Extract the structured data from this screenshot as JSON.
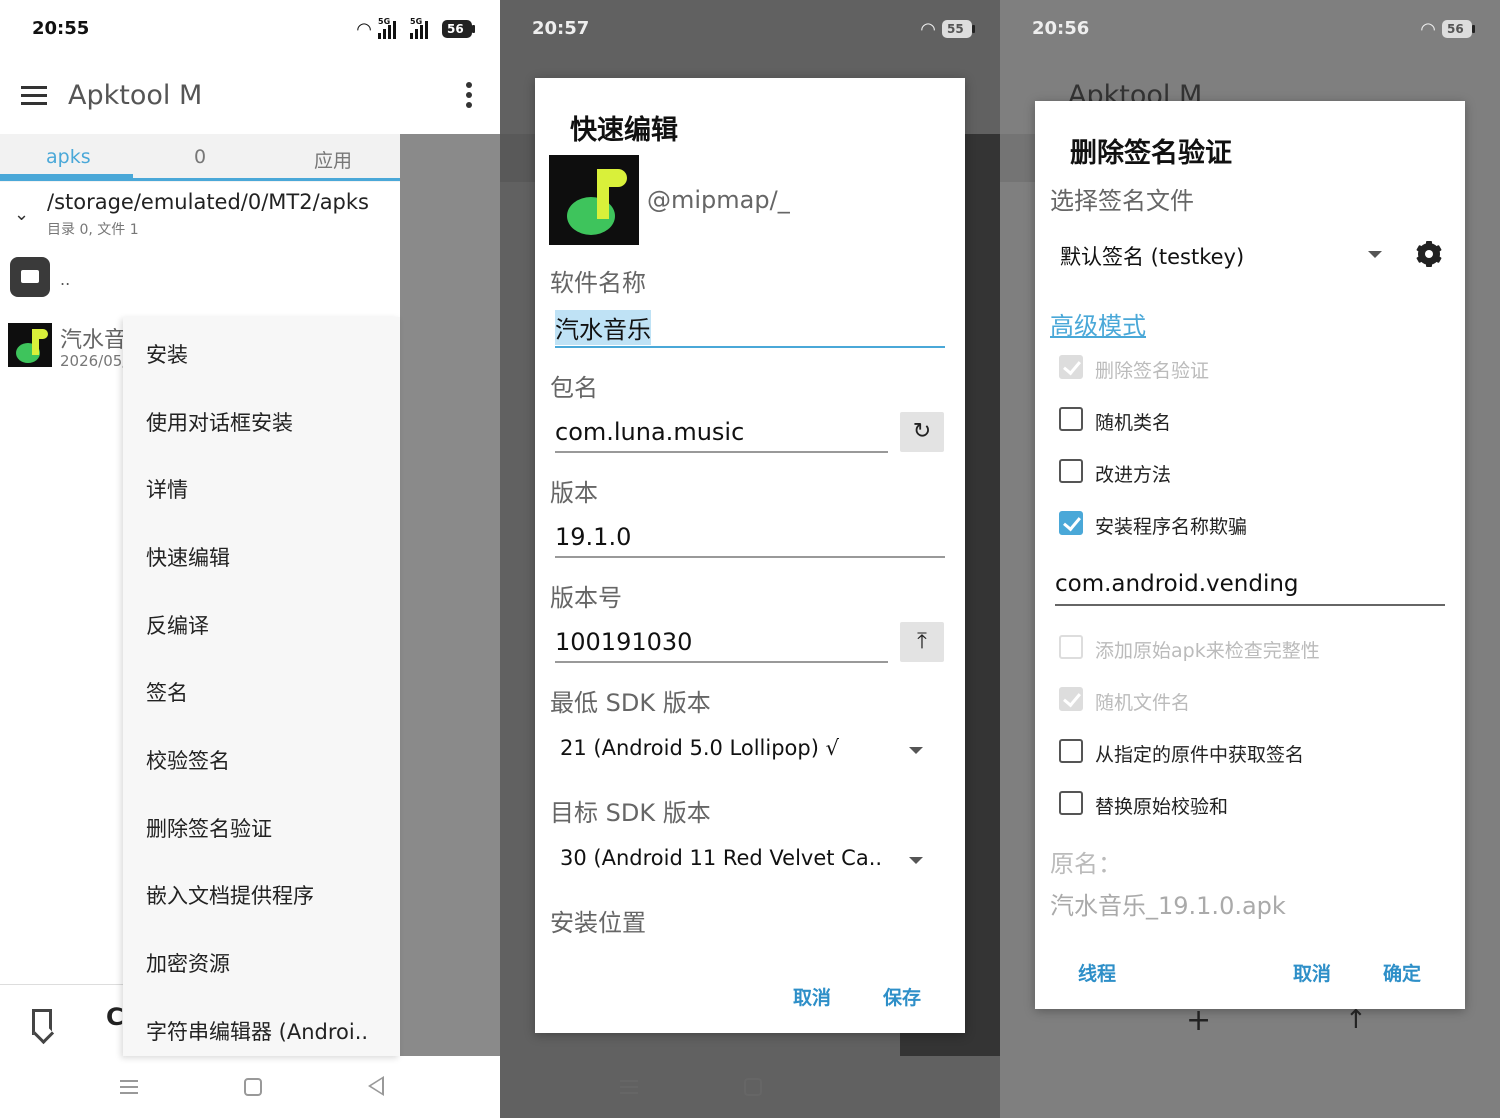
{
  "panel1": {
    "status": {
      "time": "20:55",
      "battery": "56"
    },
    "appbar": {
      "title": "Apktool M"
    },
    "tabs": [
      "apks",
      "0",
      "应用"
    ],
    "path": {
      "text": "/storage/emulated/0/MT2/apks",
      "sub": "目录 0, 文件 1"
    },
    "parent_dir": "..",
    "file": {
      "name": "汽水音",
      "date": "2026/05/"
    },
    "bottom_c": "C",
    "menu": [
      "安装",
      "使用对话框安装",
      "详情",
      "快速编辑",
      "反编译",
      "签名",
      "校验签名",
      "删除签名验证",
      "嵌入文档提供程序",
      "加密资源",
      "字符串编辑器 (Androi.."
    ]
  },
  "panel2": {
    "status": {
      "time": "20:57",
      "battery": "55"
    },
    "dialog": {
      "title": "快速编辑",
      "handle": "@mipmap/_",
      "app_name_label": "软件名称",
      "app_name": "汽水音乐",
      "package_label": "包名",
      "package": "com.luna.music",
      "version_label": "版本",
      "version": "19.1.0",
      "version_code_label": "版本号",
      "version_code": "100191030",
      "min_sdk_label": "最低 SDK 版本",
      "min_sdk": "21 (Android 5.0 Lollipop) √",
      "target_sdk_label": "目标 SDK 版本",
      "target_sdk": "30 (Android 11 Red Velvet Ca..",
      "install_location_label": "安装位置",
      "cancel": "取消",
      "save": "保存"
    }
  },
  "panel3": {
    "status": {
      "time": "20:56",
      "battery": "56"
    },
    "bg_title": "Apktool M",
    "dialog": {
      "title": "删除签名验证",
      "select_label": "选择签名文件",
      "signature": "默认签名 (testkey)",
      "advanced": "高级模式",
      "options": [
        {
          "label": "删除签名验证",
          "state": "disabled-checked"
        },
        {
          "label": "随机类名",
          "state": "unchecked"
        },
        {
          "label": "改进方法",
          "state": "unchecked"
        },
        {
          "label": "安装程序名称欺骗",
          "state": "checked"
        }
      ],
      "installer": "com.android.vending",
      "options2": [
        {
          "label": "添加原始apk来检查完整性",
          "state": "disabled"
        },
        {
          "label": "随机文件名",
          "state": "disabled-checked"
        },
        {
          "label": "从指定的原件中获取签名",
          "state": "unchecked"
        },
        {
          "label": "替换原始校验和",
          "state": "unchecked"
        }
      ],
      "orig_label": "原名：",
      "orig_name": "汽水音乐_19.1.0.apk",
      "thread": "线程",
      "cancel": "取消",
      "ok": "确定"
    }
  },
  "colors": {
    "accent": "#4aa8d8",
    "button_text": "#2e8fc8"
  }
}
